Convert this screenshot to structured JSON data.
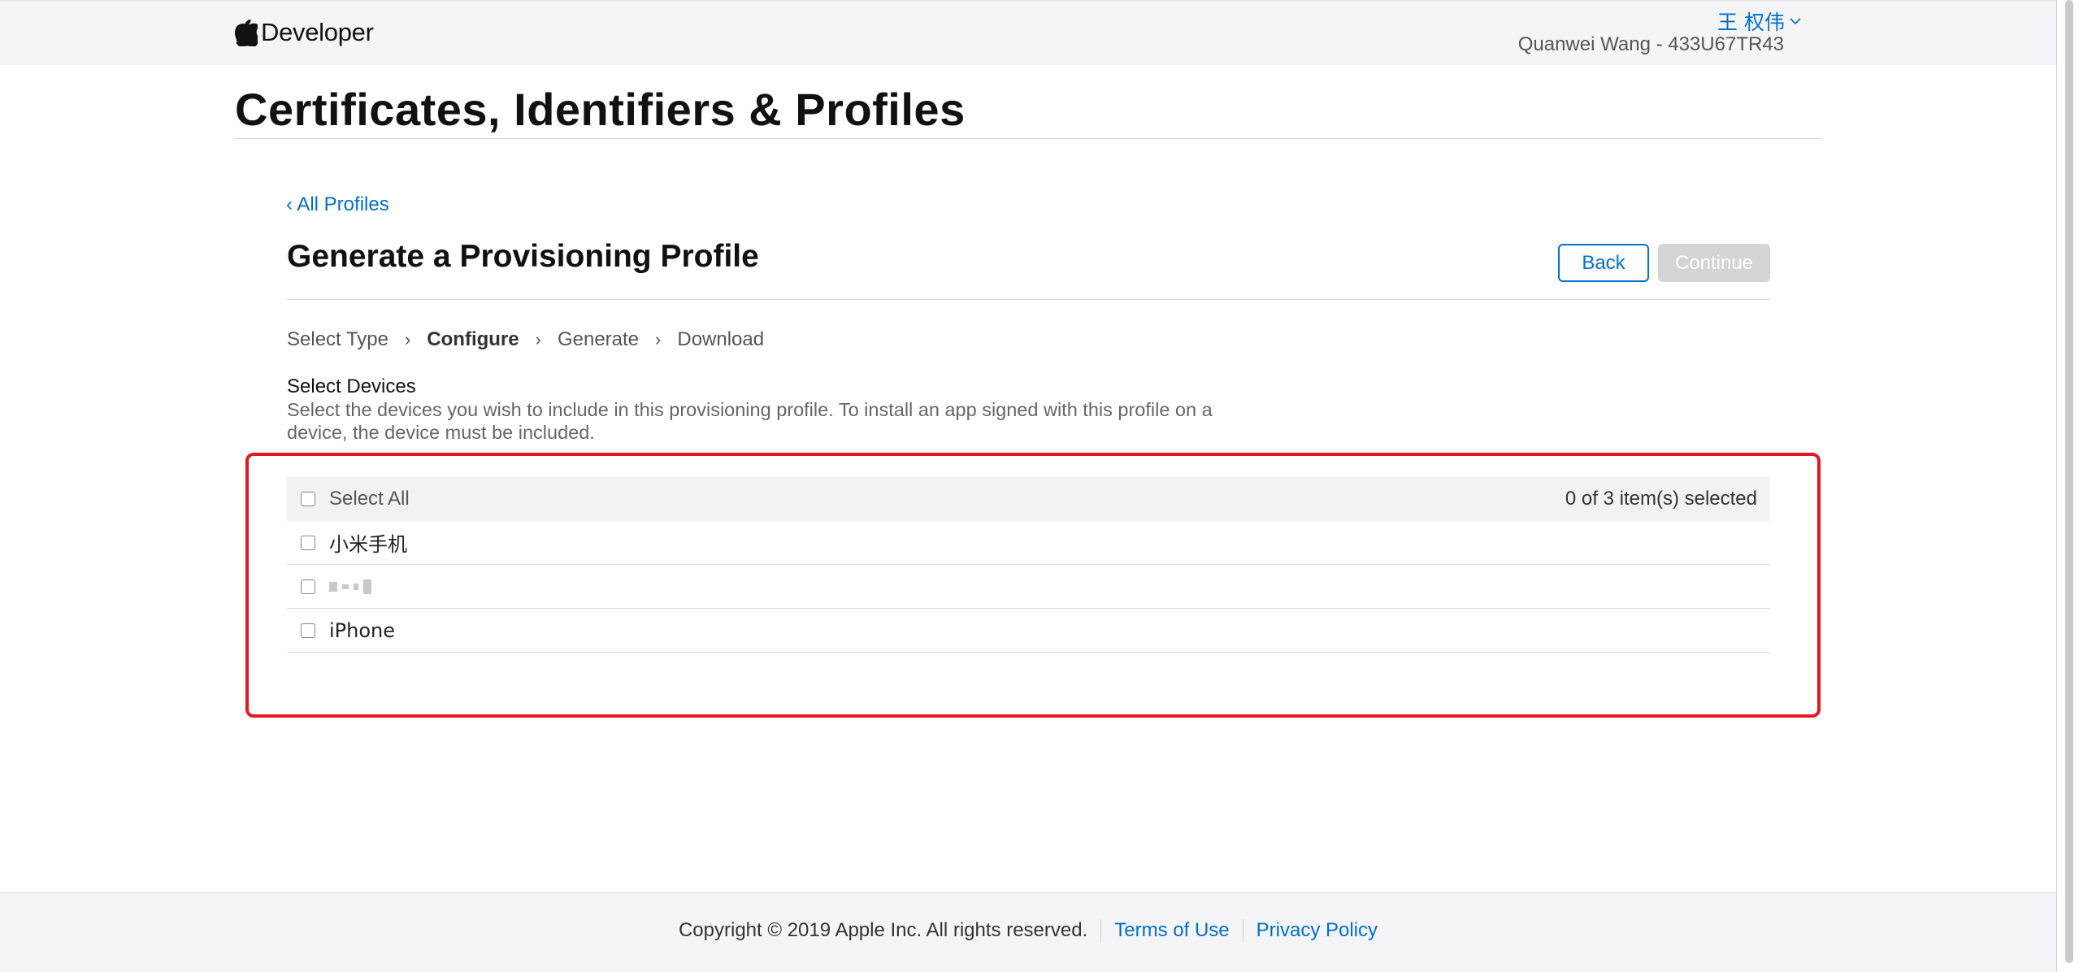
{
  "header": {
    "brand": "Developer",
    "account_name": "王 权伟",
    "account_team": "Quanwei Wang - 433U67TR43"
  },
  "page": {
    "title": "Certificates, Identifiers & Profiles",
    "back_link": "‹ All Profiles",
    "section_title": "Generate a Provisioning Profile",
    "back_button": "Back",
    "continue_button": "Continue"
  },
  "steps": [
    {
      "label": "Select Type",
      "active": false
    },
    {
      "label": "Configure",
      "active": true
    },
    {
      "label": "Generate",
      "active": false
    },
    {
      "label": "Download",
      "active": false
    }
  ],
  "devices": {
    "heading": "Select Devices",
    "description": "Select the devices you wish to include in this provisioning profile. To install an app signed with this profile on a device, the device must be included.",
    "select_all": "Select All",
    "selected_count": "0 of 3 item(s) selected",
    "items": [
      {
        "label": "小米手机",
        "checked": false
      },
      {
        "label": "",
        "checked": false,
        "redacted": true
      },
      {
        "label": "iPhone",
        "checked": false
      }
    ]
  },
  "footer": {
    "copyright": "Copyright © 2019 Apple Inc. All rights reserved.",
    "terms": "Terms of Use",
    "privacy": "Privacy Policy"
  },
  "colors": {
    "accent": "#0070c9",
    "highlight": "#e01922",
    "header_bg": "#f5f5f7"
  }
}
